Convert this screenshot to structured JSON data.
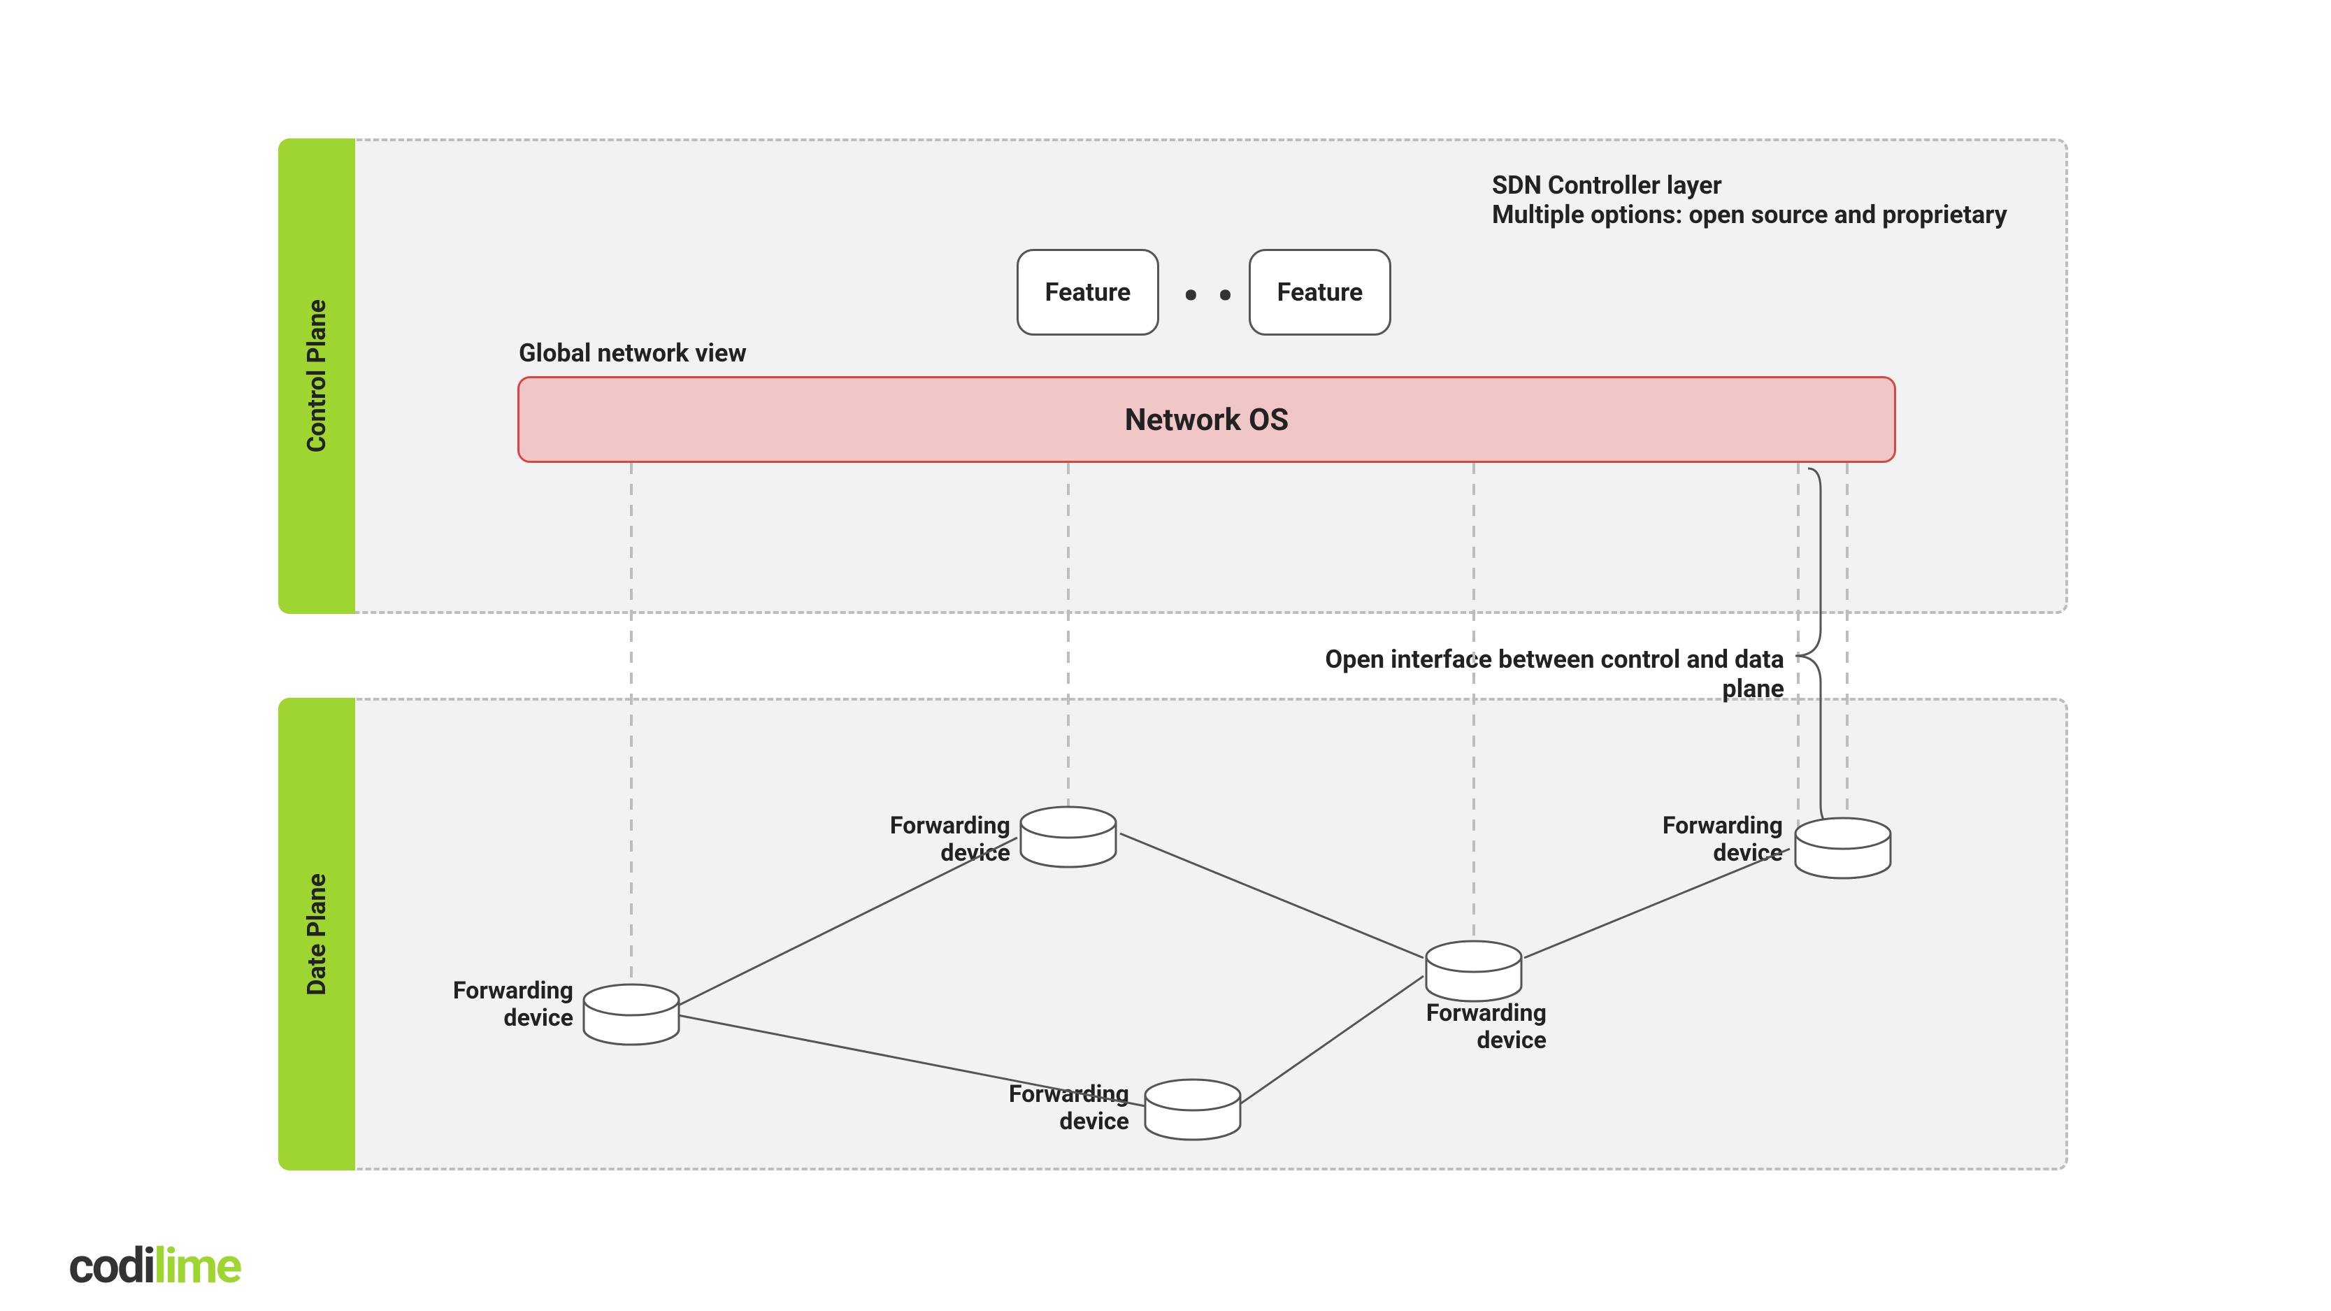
{
  "planes": {
    "control": {
      "label": "Control Plane"
    },
    "data": {
      "label": "Date Plane"
    }
  },
  "control": {
    "feature_a": "Feature",
    "feature_b": "Feature",
    "ellipsis": "• • •",
    "global_view_label": "Global network view",
    "network_os": "Network OS",
    "annotation_line1": "SDN Controller layer",
    "annotation_line2": "Multiple options: open source and proprietary"
  },
  "interface_label": "Open interface between control and data plane",
  "devices": {
    "d1": "Forwarding\ndevice",
    "d2": "Forwarding\ndevice",
    "d3": "Forwarding\ndevice",
    "d4": "Forwarding\ndevice",
    "d5": "Forwarding\ndevice"
  },
  "logo": {
    "part1": "codi",
    "part2": "lime"
  },
  "colors": {
    "accent_green": "#9ed531",
    "network_os_fill": "#f0c6c6",
    "network_os_border": "#d94545",
    "plane_bg": "#f2f2f2",
    "dash": "#bdbdbd"
  }
}
